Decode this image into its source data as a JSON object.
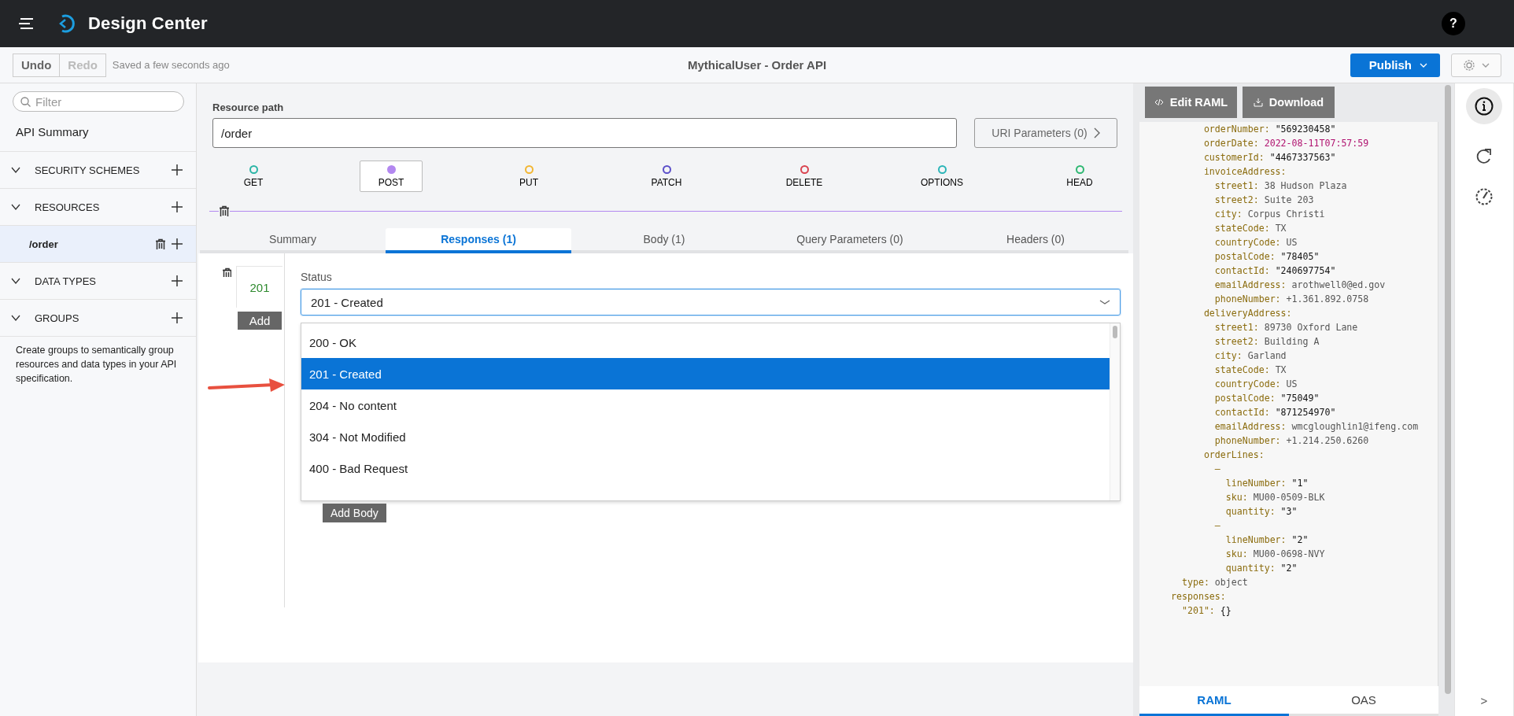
{
  "topbar": {
    "title": "Design Center",
    "help": "?"
  },
  "toolbar": {
    "history_buttons": [
      {
        "label": "Undo",
        "disabled": false
      },
      {
        "label": "Redo",
        "disabled": true
      }
    ],
    "saved_status": "Saved a few seconds ago",
    "document_title": "MythicalUser - Order API",
    "publish_button": "Publish"
  },
  "sidebar": {
    "filter_placeholder": "Filter",
    "summary": "API Summary",
    "sections": [
      {
        "label": "SECURITY SCHEMES",
        "expanded": true
      },
      {
        "label": "RESOURCES",
        "expanded": true,
        "items": [
          {
            "label": "/order",
            "selected": true
          }
        ]
      },
      {
        "label": "DATA TYPES",
        "expanded": true
      },
      {
        "label": "GROUPS",
        "expanded": true,
        "description": "Create groups to semantically group resources and data types in your API specification."
      }
    ]
  },
  "editor": {
    "resource_path_label": "Resource path",
    "resource_path": "/order",
    "uri_button": "URI Parameters (0)",
    "methods": [
      {
        "label": "GET",
        "color": "#2bb5a6",
        "selected": false
      },
      {
        "label": "POST",
        "color": "#b388f0",
        "selected": true
      },
      {
        "label": "PUT",
        "color": "#f2b632",
        "selected": false
      },
      {
        "label": "PATCH",
        "color": "#5b4fc9",
        "selected": false
      },
      {
        "label": "DELETE",
        "color": "#d9434f",
        "selected": false
      },
      {
        "label": "OPTIONS",
        "color": "#2bb5b8",
        "selected": false
      },
      {
        "label": "HEAD",
        "color": "#2eb872",
        "selected": false
      }
    ],
    "tabs": [
      {
        "label": "Summary",
        "selected": false
      },
      {
        "label": "Responses (1)",
        "selected": true
      },
      {
        "label": "Body (1)",
        "selected": false
      },
      {
        "label": "Query Parameters (0)",
        "selected": false
      },
      {
        "label": "Headers (0)",
        "selected": false
      }
    ],
    "response": {
      "code": "201",
      "add_button": "Add",
      "status_label": "Status",
      "status_value": "201 - Created",
      "options": [
        {
          "label": "200 - OK",
          "selected": false
        },
        {
          "label": "201 - Created",
          "selected": true
        },
        {
          "label": "204 - No content",
          "selected": false
        },
        {
          "label": "304 - Not Modified",
          "selected": false
        },
        {
          "label": "400 - Bad Request",
          "selected": false
        }
      ],
      "add_body_button": "Add Body"
    }
  },
  "code_panel": {
    "buttons": [
      {
        "label": "Edit RAML",
        "kind": "code"
      },
      {
        "label": "Download",
        "kind": "download"
      }
    ],
    "lines": [
      {
        "key": "      orderNumber:",
        "value": "\"569230458\"",
        "kind": "quoted"
      },
      {
        "key": "      orderDate:",
        "value": "2022-08-11T07:57:59",
        "kind": "date"
      },
      {
        "key": "      customerId:",
        "value": "\"4467337563\"",
        "kind": "quoted"
      },
      {
        "key": "      invoiceAddress:",
        "kind": "none"
      },
      {
        "key": "        street1:",
        "value": "38 Hudson Plaza",
        "kind": "plain"
      },
      {
        "key": "        street2:",
        "value": "Suite 203",
        "kind": "plain"
      },
      {
        "key": "        city:",
        "value": "Corpus Christi",
        "kind": "plain"
      },
      {
        "key": "        stateCode:",
        "value": "TX",
        "kind": "plain"
      },
      {
        "key": "        countryCode:",
        "value": "US",
        "kind": "plain"
      },
      {
        "key": "        postalCode:",
        "value": "\"78405\"",
        "kind": "quoted"
      },
      {
        "key": "        contactId:",
        "value": "\"240697754\"",
        "kind": "quoted"
      },
      {
        "key": "        emailAddress:",
        "value": "arothwell0@ed.gov",
        "kind": "plain"
      },
      {
        "key": "        phoneNumber:",
        "value": "+1.361.892.0758",
        "kind": "plain"
      },
      {
        "key": "      deliveryAddress:",
        "kind": "none"
      },
      {
        "key": "        street1:",
        "value": "89730 Oxford Lane",
        "kind": "plain"
      },
      {
        "key": "        street2:",
        "value": "Building A",
        "kind": "plain"
      },
      {
        "key": "        city:",
        "value": "Garland",
        "kind": "plain"
      },
      {
        "key": "        stateCode:",
        "value": "TX",
        "kind": "plain"
      },
      {
        "key": "        countryCode:",
        "value": "US",
        "kind": "plain"
      },
      {
        "key": "        postalCode:",
        "value": "\"75049\"",
        "kind": "quoted"
      },
      {
        "key": "        contactId:",
        "value": "\"871254970\"",
        "kind": "quoted"
      },
      {
        "key": "        emailAddress:",
        "value": "wmcgloughlin1@ifeng.com",
        "kind": "plain"
      },
      {
        "key": "        phoneNumber:",
        "value": "+1.214.250.6260",
        "kind": "plain"
      },
      {
        "key": "      orderLines:",
        "kind": "none"
      },
      {
        "key": "        –",
        "kind": "none"
      },
      {
        "key": "          lineNumber:",
        "value": "\"1\"",
        "kind": "quoted"
      },
      {
        "key": "          sku:",
        "value": "MU00-0509-BLK",
        "kind": "plain"
      },
      {
        "key": "          quantity:",
        "value": "\"3\"",
        "kind": "quoted"
      },
      {
        "key": "        –",
        "kind": "none"
      },
      {
        "key": "          lineNumber:",
        "value": "\"2\"",
        "kind": "quoted"
      },
      {
        "key": "          sku:",
        "value": "MU00-0698-NVY",
        "kind": "plain"
      },
      {
        "key": "          quantity:",
        "value": "\"2\"",
        "kind": "quoted"
      },
      {
        "key": "  type:",
        "value": "object",
        "kind": "plain"
      },
      {
        "key": "responses:",
        "kind": "none"
      },
      {
        "key": "  \"201\":",
        "value": "{}",
        "kind": "quoted"
      }
    ],
    "tabs": [
      {
        "label": "RAML",
        "selected": true
      },
      {
        "label": "OAS",
        "selected": false
      }
    ]
  },
  "rail": {
    "collapse": ">"
  }
}
